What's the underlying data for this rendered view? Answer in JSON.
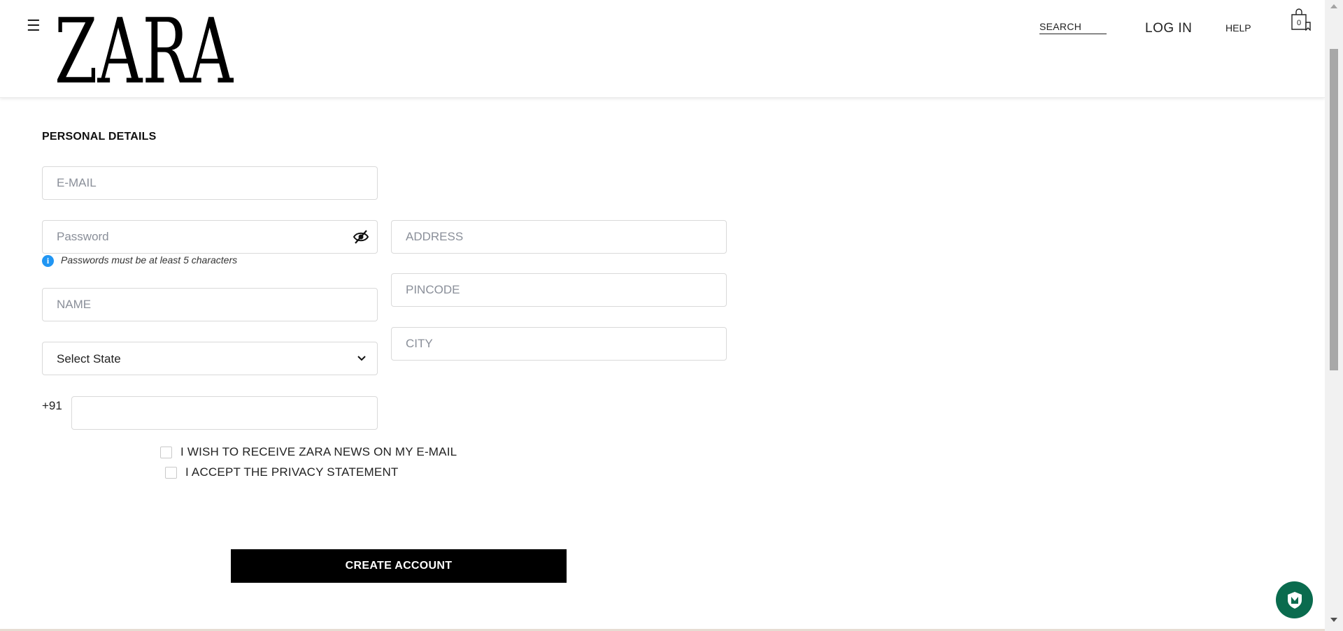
{
  "header": {
    "menu_icon": "hamburger-icon",
    "logo": "ZARA",
    "nav": {
      "search": "SEARCH",
      "login": "LOG IN",
      "help": "HELP"
    },
    "cart_count": "0",
    "cart_icon": "shopping-bag-icon"
  },
  "form": {
    "section_title": "PERSONAL DETAILS",
    "email_placeholder": "E-MAIL",
    "password_placeholder": "Password",
    "password_hint": "Passwords must be at least 5 characters",
    "name_placeholder": "NAME",
    "state_select": "Select State",
    "phone_prefix": "+91",
    "phone_value": "",
    "address_placeholder": "ADDRESS",
    "pincode_placeholder": "PINCODE",
    "city_placeholder": "CITY",
    "newsletter_label": "I WISH TO RECEIVE ZARA NEWS ON MY E-MAIL",
    "privacy_label": "I ACCEPT THE PRIVACY STATEMENT",
    "submit_label": "CREATE ACCOUNT"
  },
  "colors": {
    "button_bg": "#000000",
    "info_icon": "#2196f3",
    "security_badge": "#0a6b4e"
  }
}
